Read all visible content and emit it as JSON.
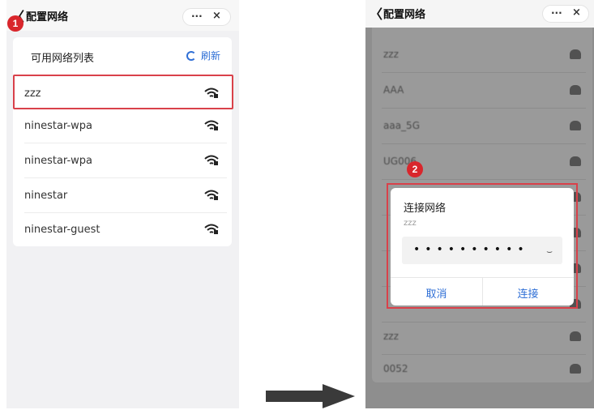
{
  "left": {
    "nav": {
      "back": "〈",
      "title": "配置网络",
      "more": "···",
      "close": "×"
    },
    "badge": "1",
    "list_title": "可用网络列表",
    "refresh_label": "刷新",
    "networks": [
      {
        "name": "zzz"
      },
      {
        "name": "ninestar-wpa"
      },
      {
        "name": "ninestar-wpa"
      },
      {
        "name": "ninestar"
      },
      {
        "name": "ninestar-guest"
      }
    ]
  },
  "right": {
    "nav": {
      "back": "〈",
      "title": "配置网络",
      "more": "···",
      "close": "×"
    },
    "networks": [
      {
        "name": "zzz"
      },
      {
        "name": "AAA"
      },
      {
        "name": "aaa_5G"
      },
      {
        "name": "UG006"
      },
      {
        "name": ""
      },
      {
        "name": ""
      },
      {
        "name": ""
      },
      {
        "name": ""
      },
      {
        "name": "zzz"
      },
      {
        "name": "0052"
      }
    ],
    "badge": "2",
    "dialog": {
      "title": "连接网络",
      "ssid": "zzz",
      "password_mask": "••••••••••",
      "eye": "⌣",
      "cancel": "取消",
      "connect": "连接"
    }
  },
  "colors": {
    "accent": "#2f6fd6",
    "highlight": "#d9414a",
    "badge": "#d9262c"
  }
}
